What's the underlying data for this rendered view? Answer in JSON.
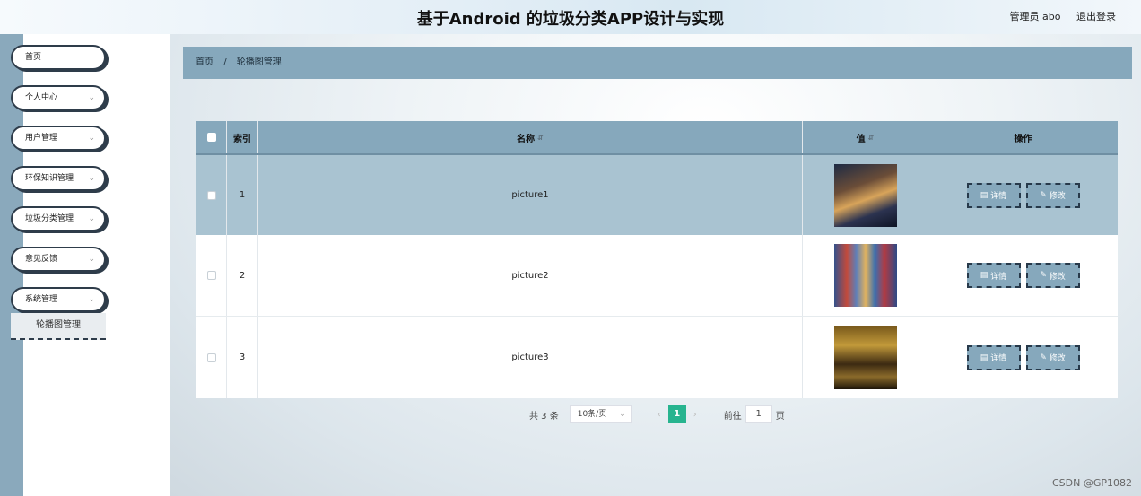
{
  "header": {
    "title": "基于Android 的垃圾分类APP设计与实现",
    "user": "管理员 abo",
    "logout": "退出登录"
  },
  "sidebar": {
    "items": [
      {
        "label": "首页",
        "has_chevron": false
      },
      {
        "label": "个人中心",
        "has_chevron": true
      },
      {
        "label": "用户管理",
        "has_chevron": true
      },
      {
        "label": "环保知识管理",
        "has_chevron": true
      },
      {
        "label": "垃圾分类管理",
        "has_chevron": true
      },
      {
        "label": "意见反馈",
        "has_chevron": true
      },
      {
        "label": "系统管理",
        "has_chevron": true
      }
    ],
    "sub_item": "轮播图管理",
    "chevron_icon": "chevron-down-icon"
  },
  "breadcrumb": {
    "home": "首页",
    "sep": "/",
    "current": "轮播图管理"
  },
  "table": {
    "columns": [
      "索引",
      "名称",
      "值",
      "操作"
    ],
    "rows": [
      {
        "index": "1",
        "name": "picture1",
        "thumb": "city-night",
        "selected": true
      },
      {
        "index": "2",
        "name": "picture2",
        "thumb": "city-lights",
        "selected": false
      },
      {
        "index": "3",
        "name": "picture3",
        "thumb": "city-gold",
        "selected": false
      }
    ],
    "detail_label": "详情",
    "edit_label": "修改",
    "sort_icon": "sort-icon"
  },
  "pagination": {
    "total": "共 3 条",
    "page_size": "10条/页",
    "current_page": "1",
    "goto_label": "前往",
    "goto_value": "1",
    "page_suffix": "页"
  },
  "watermark": "CSDN @GP1082",
  "colors": {
    "accent": "#86a8bc",
    "selected_row": "#a9c3d1",
    "page_active": "#27b48f",
    "border_dark": "#27394a"
  }
}
